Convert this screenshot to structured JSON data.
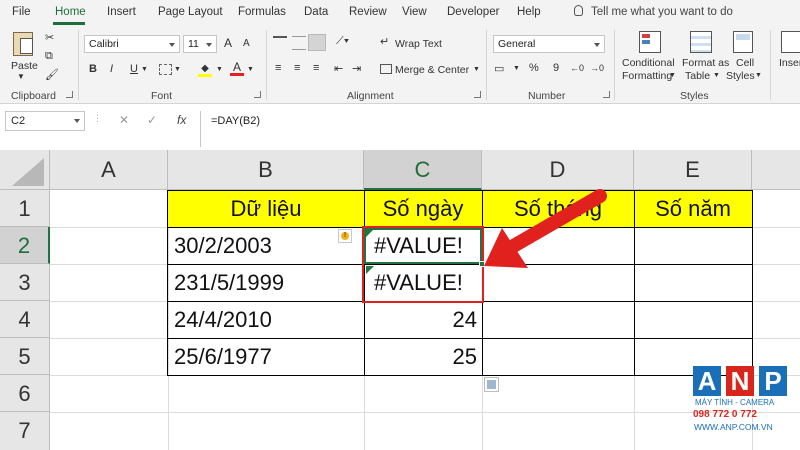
{
  "menu": {
    "tabs": [
      "File",
      "Home",
      "Insert",
      "Page Layout",
      "Formulas",
      "Data",
      "Review",
      "View",
      "Developer",
      "Help"
    ],
    "active_tab": "Home",
    "tell_me": "Tell me what you want to do"
  },
  "ribbon": {
    "clipboard": {
      "paste": "Paste",
      "label": "Clipboard"
    },
    "font": {
      "family": "Calibri",
      "size": "11",
      "bold": "B",
      "italic": "I",
      "underline": "U",
      "increase": "A",
      "decrease": "A",
      "label": "Font"
    },
    "alignment": {
      "wrap_text": "Wrap Text",
      "merge_center": "Merge & Center",
      "label": "Alignment"
    },
    "number": {
      "format": "General",
      "currency": "$",
      "percent": "%",
      "comma": "9",
      "label": "Number"
    },
    "styles": {
      "conditional_line1": "Conditional",
      "conditional_line2": "Formatting",
      "format_as_line1": "Format as",
      "format_as_line2": "Table",
      "cell_line1": "Cell",
      "cell_line2": "Styles",
      "label": "Styles"
    },
    "insert_partial": "Inser"
  },
  "formula_bar": {
    "name_box": "C2",
    "cancel": "✕",
    "enter": "✓",
    "fx": "fx",
    "formula": "=DAY(B2)"
  },
  "sheet": {
    "columns": [
      "A",
      "B",
      "C",
      "D",
      "E"
    ],
    "selected_column": "C",
    "rows": [
      "1",
      "2",
      "3",
      "4",
      "5",
      "6",
      "7"
    ],
    "selected_row": "2",
    "headers": {
      "b": "Dữ liệu",
      "c": "Số ngày",
      "d": "Số tháng",
      "e": "Số năm"
    },
    "data": [
      {
        "b": "30/2/2003",
        "c": "#VALUE!"
      },
      {
        "b": "231/5/1999",
        "c": "#VALUE!"
      },
      {
        "b": "24/4/2010",
        "c": "24"
      },
      {
        "b": "25/6/1977",
        "c": "25"
      }
    ],
    "header_fill": "#ffff00",
    "highlight_color": "#e1211d"
  },
  "watermark": {
    "letters": [
      "A",
      "N",
      "P"
    ],
    "tile_colors": [
      "#1a6fb8",
      "#d9261c",
      "#1a6fb8"
    ],
    "line1": "MÁY TÍNH - CAMERA",
    "line2": "098 772 0 772",
    "line3": "WWW.ANP.COM.VN"
  }
}
